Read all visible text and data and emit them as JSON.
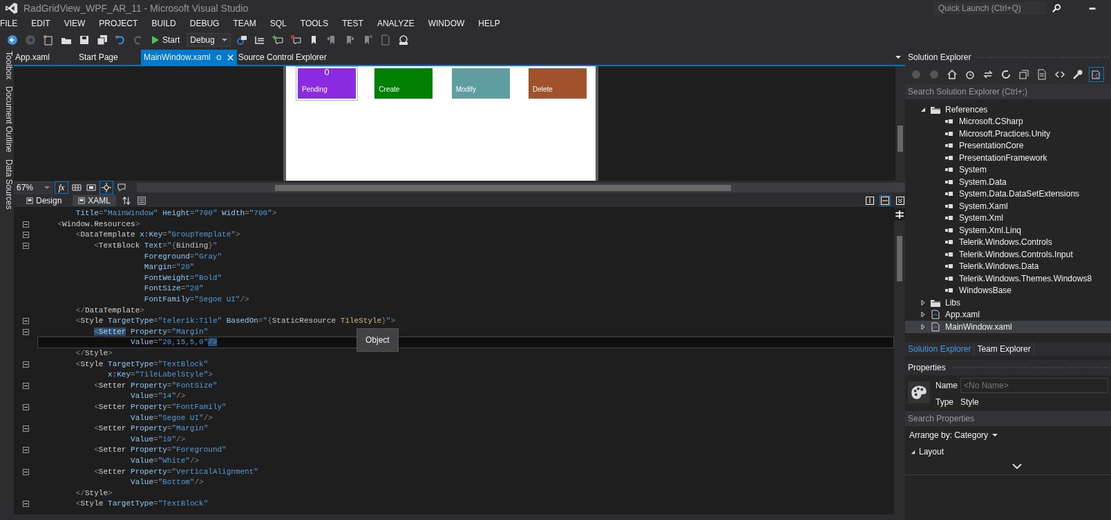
{
  "window": {
    "title": "RadGridView_WPF_AR_11 - Microsoft Visual Studio",
    "quick_launch": {
      "placeholder": "Quick Launch (Ctrl+Q)"
    }
  },
  "menu": [
    "FILE",
    "EDIT",
    "VIEW",
    "PROJECT",
    "BUILD",
    "DEBUG",
    "TEAM",
    "SQL",
    "TOOLS",
    "TEST",
    "ANALYZE",
    "WINDOW",
    "HELP"
  ],
  "toolbar": {
    "start_button": "Start",
    "configuration": "Debug"
  },
  "side_tabs": [
    "Toolbox",
    "Document Outline",
    "Data Sources"
  ],
  "document_tabs": [
    {
      "label": "App.xaml",
      "selected": false
    },
    {
      "label": "Start Page",
      "selected": false
    },
    {
      "label": "MainWindow.xaml",
      "selected": true
    },
    {
      "label": "Source Control Explorer",
      "selected": false
    }
  ],
  "designer": {
    "tiles": [
      {
        "label": "Pending",
        "count": "0",
        "color": "#8a2be2",
        "selected": true
      },
      {
        "label": "Create",
        "color": "#008000",
        "selected": false
      },
      {
        "label": "Modify",
        "color": "#5f9ea0",
        "selected": false
      },
      {
        "label": "Delete",
        "color": "#a0522d",
        "selected": false
      }
    ],
    "zoom": "67%",
    "formula_button": "fx"
  },
  "view_tabs": [
    {
      "label": "Design",
      "selected": false
    },
    {
      "label": "XAML",
      "selected": true
    }
  ],
  "editor": {
    "tooltip": "Object",
    "lines": [
      {
        "fold": false,
        "current": false,
        "tokens": [
          {
            "kind": "attr",
            "t": "        Title"
          },
          {
            "kind": "p",
            "t": "="
          },
          {
            "kind": "val",
            "t": "\"MainWindow\""
          },
          {
            "kind": "attr",
            "t": " Height"
          },
          {
            "kind": "p",
            "t": "="
          },
          {
            "kind": "val",
            "t": "\"700\""
          },
          {
            "kind": "attr",
            "t": " Width"
          },
          {
            "kind": "p",
            "t": "="
          },
          {
            "kind": "val",
            "t": "\"700\""
          },
          {
            "kind": "p",
            "t": ">"
          }
        ]
      },
      {
        "fold": true,
        "current": false,
        "tokens": [
          {
            "kind": "p",
            "t": "    <"
          },
          {
            "kind": "tag",
            "t": "Window.Resources"
          },
          {
            "kind": "p",
            "t": ">"
          }
        ]
      },
      {
        "fold": true,
        "current": false,
        "tokens": [
          {
            "kind": "p",
            "t": "        <"
          },
          {
            "kind": "tag",
            "t": "DataTemplate"
          },
          {
            "kind": "attr",
            "t": " x:Key"
          },
          {
            "kind": "p",
            "t": "="
          },
          {
            "kind": "val",
            "t": "\"GroupTemplate\""
          },
          {
            "kind": "p",
            "t": ">"
          }
        ]
      },
      {
        "fold": true,
        "current": false,
        "tokens": [
          {
            "kind": "p",
            "t": "            <"
          },
          {
            "kind": "tag",
            "t": "TextBlock"
          },
          {
            "kind": "attr",
            "t": " Text"
          },
          {
            "kind": "p",
            "t": "="
          },
          {
            "kind": "val",
            "t": "\""
          },
          {
            "kind": "p",
            "t": "{"
          },
          {
            "kind": "ext",
            "t": "Binding"
          },
          {
            "kind": "p",
            "t": "}"
          },
          {
            "kind": "val",
            "t": "\""
          }
        ]
      },
      {
        "fold": false,
        "current": false,
        "tokens": [
          {
            "kind": "attr",
            "t": "                       Foreground"
          },
          {
            "kind": "p",
            "t": "="
          },
          {
            "kind": "val",
            "t": "\"Gray\""
          }
        ]
      },
      {
        "fold": false,
        "current": false,
        "tokens": [
          {
            "kind": "attr",
            "t": "                       Margin"
          },
          {
            "kind": "p",
            "t": "="
          },
          {
            "kind": "val",
            "t": "\"20\""
          }
        ]
      },
      {
        "fold": false,
        "current": false,
        "tokens": [
          {
            "kind": "attr",
            "t": "                       FontWeight"
          },
          {
            "kind": "p",
            "t": "="
          },
          {
            "kind": "val",
            "t": "\"Bold\""
          }
        ]
      },
      {
        "fold": false,
        "current": false,
        "tokens": [
          {
            "kind": "attr",
            "t": "                       FontSize"
          },
          {
            "kind": "p",
            "t": "="
          },
          {
            "kind": "val",
            "t": "\"20\""
          }
        ]
      },
      {
        "fold": false,
        "current": false,
        "tokens": [
          {
            "kind": "attr",
            "t": "                       FontFamily"
          },
          {
            "kind": "p",
            "t": "="
          },
          {
            "kind": "val",
            "t": "\"Segoe UI\""
          },
          {
            "kind": "p",
            "t": "/>"
          }
        ]
      },
      {
        "fold": false,
        "current": false,
        "tokens": [
          {
            "kind": "p",
            "t": "        </"
          },
          {
            "kind": "tag",
            "t": "DataTemplate"
          },
          {
            "kind": "p",
            "t": ">"
          }
        ]
      },
      {
        "fold": true,
        "current": false,
        "tokens": [
          {
            "kind": "p",
            "t": "        <"
          },
          {
            "kind": "tag",
            "t": "Style"
          },
          {
            "kind": "attr",
            "t": " TargetType"
          },
          {
            "kind": "p",
            "t": "="
          },
          {
            "kind": "val",
            "t": "\"telerik:Tile\""
          },
          {
            "kind": "attr",
            "t": " BasedOn"
          },
          {
            "kind": "p",
            "t": "="
          },
          {
            "kind": "val",
            "t": "\""
          },
          {
            "kind": "p",
            "t": "{"
          },
          {
            "kind": "ext",
            "t": "StaticResource"
          },
          {
            "kind": "arg",
            "t": " TileStyle"
          },
          {
            "kind": "p",
            "t": "}"
          },
          {
            "kind": "val",
            "t": "\""
          },
          {
            "kind": "p",
            "t": ">"
          }
        ]
      },
      {
        "fold": true,
        "current": false,
        "tokens": [
          {
            "kind": "p",
            "t": "            <",
            "highlight": true
          },
          {
            "kind": "tag",
            "t": "Setter",
            "highlight": true
          },
          {
            "kind": "attr",
            "t": " Property"
          },
          {
            "kind": "p",
            "t": "="
          },
          {
            "kind": "val",
            "t": "\"Margin\""
          }
        ]
      },
      {
        "fold": false,
        "current": true,
        "tokens": [
          {
            "kind": "attr",
            "t": "                    Value"
          },
          {
            "kind": "p",
            "t": "="
          },
          {
            "kind": "val",
            "t": "\"20,15,5,0\""
          },
          {
            "kind": "p",
            "t": "/>",
            "highlight": true
          }
        ]
      },
      {
        "fold": false,
        "current": false,
        "tokens": [
          {
            "kind": "p",
            "t": "        </"
          },
          {
            "kind": "tag",
            "t": "Style"
          },
          {
            "kind": "p",
            "t": ">"
          }
        ]
      },
      {
        "fold": true,
        "current": false,
        "tokens": [
          {
            "kind": "p",
            "t": "        <"
          },
          {
            "kind": "tag",
            "t": "Style"
          },
          {
            "kind": "attr",
            "t": " TargetType"
          },
          {
            "kind": "p",
            "t": "="
          },
          {
            "kind": "val",
            "t": "\"TextBlock\""
          }
        ]
      },
      {
        "fold": false,
        "current": false,
        "tokens": [
          {
            "kind": "attr",
            "t": "               x:Key"
          },
          {
            "kind": "p",
            "t": "="
          },
          {
            "kind": "val",
            "t": "\"TileLabelStyle\""
          },
          {
            "kind": "p",
            "t": ">"
          }
        ]
      },
      {
        "fold": true,
        "current": false,
        "tokens": [
          {
            "kind": "p",
            "t": "            <"
          },
          {
            "kind": "tag",
            "t": "Setter"
          },
          {
            "kind": "attr",
            "t": " Property"
          },
          {
            "kind": "p",
            "t": "="
          },
          {
            "kind": "val",
            "t": "\"FontSize\""
          }
        ]
      },
      {
        "fold": false,
        "current": false,
        "tokens": [
          {
            "kind": "attr",
            "t": "                    Value"
          },
          {
            "kind": "p",
            "t": "="
          },
          {
            "kind": "val",
            "t": "\"14\""
          },
          {
            "kind": "p",
            "t": "/>"
          }
        ]
      },
      {
        "fold": true,
        "current": false,
        "tokens": [
          {
            "kind": "p",
            "t": "            <"
          },
          {
            "kind": "tag",
            "t": "Setter"
          },
          {
            "kind": "attr",
            "t": " Property"
          },
          {
            "kind": "p",
            "t": "="
          },
          {
            "kind": "val",
            "t": "\"FontFamily\""
          }
        ]
      },
      {
        "fold": false,
        "current": false,
        "tokens": [
          {
            "kind": "attr",
            "t": "                    Value"
          },
          {
            "kind": "p",
            "t": "="
          },
          {
            "kind": "val",
            "t": "\"Segoe UI\""
          },
          {
            "kind": "p",
            "t": "/>"
          }
        ]
      },
      {
        "fold": true,
        "current": false,
        "tokens": [
          {
            "kind": "p",
            "t": "            <"
          },
          {
            "kind": "tag",
            "t": "Setter"
          },
          {
            "kind": "attr",
            "t": " Property"
          },
          {
            "kind": "p",
            "t": "="
          },
          {
            "kind": "val",
            "t": "\"Margin\""
          }
        ]
      },
      {
        "fold": false,
        "current": false,
        "tokens": [
          {
            "kind": "attr",
            "t": "                    Value"
          },
          {
            "kind": "p",
            "t": "="
          },
          {
            "kind": "val",
            "t": "\"10\""
          },
          {
            "kind": "p",
            "t": "/>"
          }
        ]
      },
      {
        "fold": true,
        "current": false,
        "tokens": [
          {
            "kind": "p",
            "t": "            <"
          },
          {
            "kind": "tag",
            "t": "Setter"
          },
          {
            "kind": "attr",
            "t": " Property"
          },
          {
            "kind": "p",
            "t": "="
          },
          {
            "kind": "val",
            "t": "\"Foreground\""
          }
        ]
      },
      {
        "fold": false,
        "current": false,
        "tokens": [
          {
            "kind": "attr",
            "t": "                    Value"
          },
          {
            "kind": "p",
            "t": "="
          },
          {
            "kind": "val",
            "t": "\"White\""
          },
          {
            "kind": "p",
            "t": "/>"
          }
        ]
      },
      {
        "fold": true,
        "current": false,
        "tokens": [
          {
            "kind": "p",
            "t": "            <"
          },
          {
            "kind": "tag",
            "t": "Setter"
          },
          {
            "kind": "attr",
            "t": " Property"
          },
          {
            "kind": "p",
            "t": "="
          },
          {
            "kind": "val",
            "t": "\"VerticalAlignment\""
          }
        ]
      },
      {
        "fold": false,
        "current": false,
        "tokens": [
          {
            "kind": "attr",
            "t": "                    Value"
          },
          {
            "kind": "p",
            "t": "="
          },
          {
            "kind": "val",
            "t": "\"Bottom\""
          },
          {
            "kind": "p",
            "t": "/>"
          }
        ]
      },
      {
        "fold": false,
        "current": false,
        "tokens": [
          {
            "kind": "p",
            "t": "        </"
          },
          {
            "kind": "tag",
            "t": "Style"
          },
          {
            "kind": "p",
            "t": ">"
          }
        ]
      },
      {
        "fold": true,
        "current": false,
        "tokens": [
          {
            "kind": "p",
            "t": "        <"
          },
          {
            "kind": "tag",
            "t": "Style"
          },
          {
            "kind": "attr",
            "t": " TargetType"
          },
          {
            "kind": "p",
            "t": "="
          },
          {
            "kind": "val",
            "t": "\"TextBlock\""
          }
        ]
      }
    ]
  },
  "solution_explorer": {
    "title": "Solution Explorer",
    "search": {
      "placeholder": "Search Solution Explorer (Ctrl+;)"
    },
    "tree": [
      {
        "label": "References",
        "kind": "folder",
        "expanded": true,
        "selected": false,
        "children": [
          {
            "label": "Microsoft.CSharp",
            "kind": "reference",
            "selected": false
          },
          {
            "label": "Microsoft.Practices.Unity",
            "kind": "reference",
            "selected": false
          },
          {
            "label": "PresentationCore",
            "kind": "reference",
            "selected": false
          },
          {
            "label": "PresentationFramework",
            "kind": "reference",
            "selected": false
          },
          {
            "label": "System",
            "kind": "reference",
            "selected": false
          },
          {
            "label": "System.Data",
            "kind": "reference",
            "selected": false
          },
          {
            "label": "System.Data.DataSetExtensions",
            "kind": "reference",
            "selected": false
          },
          {
            "label": "System.Xaml",
            "kind": "reference",
            "selected": false
          },
          {
            "label": "System.Xml",
            "kind": "reference",
            "selected": false
          },
          {
            "label": "System.Xml.Linq",
            "kind": "reference",
            "selected": false
          },
          {
            "label": "Telerik.Windows.Controls",
            "kind": "reference",
            "selected": false
          },
          {
            "label": "Telerik.Windows.Controls.Input",
            "kind": "reference",
            "selected": false
          },
          {
            "label": "Telerik.Windows.Data",
            "kind": "reference",
            "selected": false
          },
          {
            "label": "Telerik.Windows.Themes.Windows8",
            "kind": "reference",
            "selected": false
          },
          {
            "label": "WindowsBase",
            "kind": "reference",
            "selected": false
          }
        ]
      },
      {
        "label": "Libs",
        "kind": "folder",
        "expanded": false,
        "selected": false
      },
      {
        "label": "App.xaml",
        "kind": "file",
        "expanded": false,
        "selected": false
      },
      {
        "label": "MainWindow.xaml",
        "kind": "file",
        "expanded": false,
        "selected": true
      }
    ],
    "tabs": [
      {
        "label": "Solution Explorer",
        "selected": true
      },
      {
        "label": "Team Explorer",
        "selected": false
      }
    ]
  },
  "properties": {
    "title": "Properties",
    "name_label": "Name",
    "name_field": {
      "placeholder": "<No Name>"
    },
    "type_label": "Type",
    "type_value": "Style",
    "search": {
      "placeholder": "Search Properties"
    },
    "arrange_by": "Arrange by: Category",
    "sections": [
      {
        "label": "Layout",
        "expanded": true
      }
    ]
  }
}
